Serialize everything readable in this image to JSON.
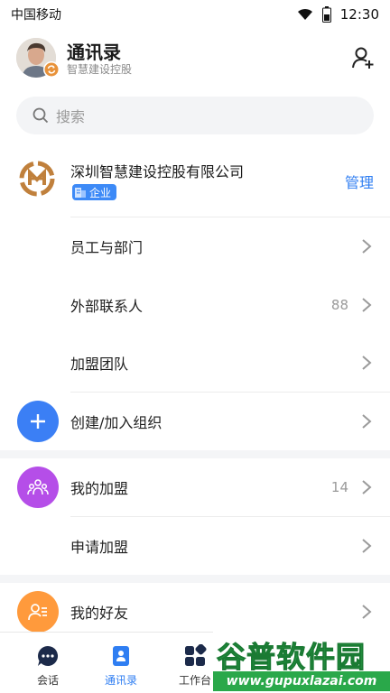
{
  "status_bar": {
    "carrier": "中国移动",
    "time": "12:30"
  },
  "header": {
    "title": "通讯录",
    "subtitle": "智慧建设控股"
  },
  "search": {
    "placeholder": "搜索"
  },
  "company": {
    "name": "深圳智慧建设控股有限公司",
    "badge": "企业",
    "manage": "管理"
  },
  "org_items": [
    {
      "label": "员工与部门",
      "count": ""
    },
    {
      "label": "外部联系人",
      "count": "88"
    },
    {
      "label": "加盟团队",
      "count": ""
    }
  ],
  "create_org": {
    "label": "创建/加入组织"
  },
  "alliance": {
    "my_alliance": "我的加盟",
    "my_alliance_count": "14",
    "apply": "申请加盟"
  },
  "friends": {
    "label": "我的好友"
  },
  "tabbar": {
    "tabs": [
      {
        "label": "会话"
      },
      {
        "label": "通讯录",
        "active": true
      },
      {
        "label": "工作台"
      }
    ]
  },
  "watermark": {
    "title": "谷普软件园",
    "url": "www.gupuxlazai.com"
  },
  "colors": {
    "accent": "#2f7ef2",
    "create_icon_bg": "#3b7ff5",
    "alliance_icon_bg": "#b54ee8",
    "friends_icon_bg": "#ff9a3c"
  }
}
